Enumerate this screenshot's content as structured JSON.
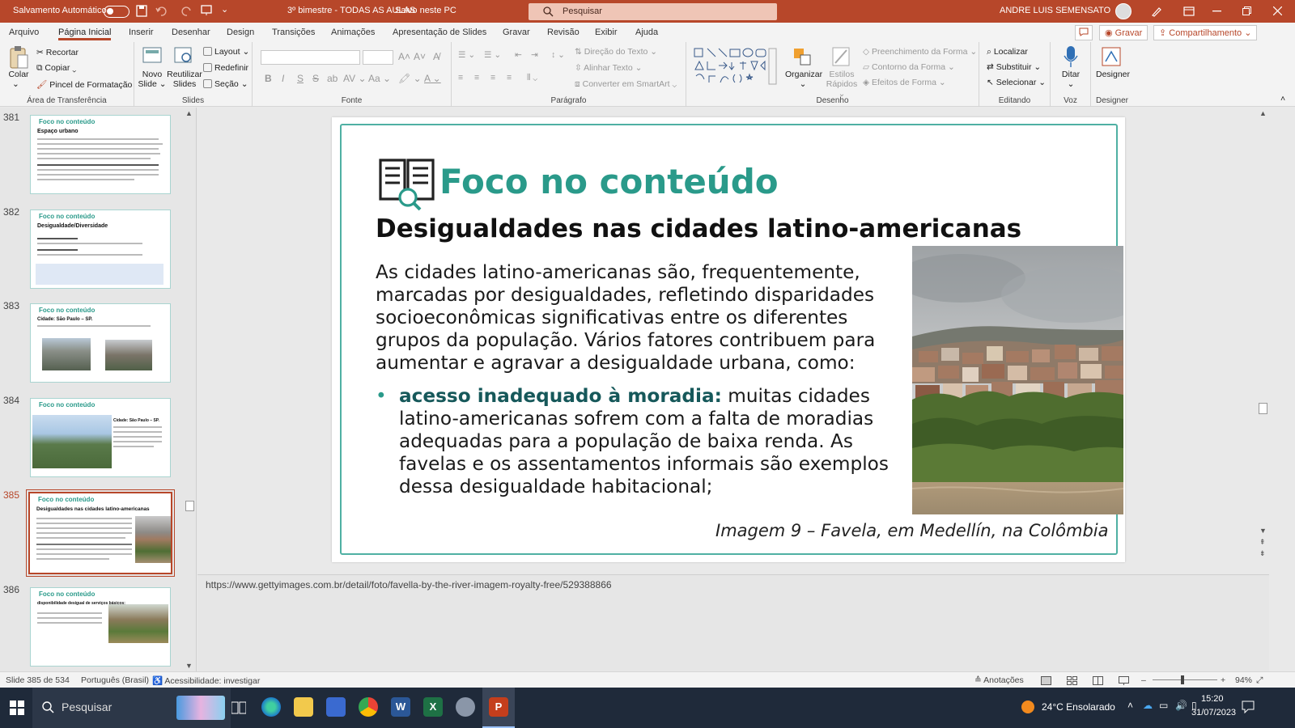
{
  "titlebar": {
    "autosave_label": "Salvamento Automático",
    "document_title": "3º bimestre - TODAS AS AULAS",
    "save_status": "Salvo neste PC",
    "search_placeholder": "Pesquisar",
    "user_name": "ANDRE LUIS SEMENSATO"
  },
  "tabs": [
    "Arquivo",
    "Página Inicial",
    "Inserir",
    "Desenhar",
    "Design",
    "Transições",
    "Animações",
    "Apresentação de Slides",
    "Gravar",
    "Revisão",
    "Exibir",
    "Ajuda"
  ],
  "tab_buttons": {
    "record": "Gravar",
    "share": "Compartilhamento"
  },
  "ribbon": {
    "clipboard": {
      "paste": "Colar",
      "cut": "Recortar",
      "copy": "Copiar",
      "format_painter": "Pincel de Formatação",
      "label": "Área de Transferência"
    },
    "slides": {
      "new_slide_1": "Novo",
      "new_slide_2": "Slide",
      "reuse_1": "Reutilizar",
      "reuse_2": "Slides",
      "layout": "Layout",
      "reset": "Redefinir",
      "section": "Seção",
      "label": "Slides"
    },
    "font": {
      "label": "Fonte"
    },
    "paragraph": {
      "text_direction": "Direção do Texto",
      "align_text": "Alinhar Texto",
      "smartart": "Converter em SmartArt",
      "label": "Parágrafo"
    },
    "drawing": {
      "arrange": "Organizar",
      "quick_styles_1": "Estilos",
      "quick_styles_2": "Rápidos",
      "shape_fill": "Preenchimento da Forma",
      "shape_outline": "Contorno da Forma",
      "shape_effects": "Efeitos de Forma",
      "label": "Desenho"
    },
    "editing": {
      "find": "Localizar",
      "replace": "Substituir",
      "select": "Selecionar",
      "label": "Editando"
    },
    "voice": {
      "dictate": "Ditar",
      "label": "Voz"
    },
    "designer": {
      "designer": "Designer",
      "label": "Designer"
    }
  },
  "thumbnails": [
    {
      "num": "381",
      "title": "Foco no conteúdo",
      "subtitle": "Espaço urbano"
    },
    {
      "num": "382",
      "title": "Foco no conteúdo",
      "subtitle": "Desigualdade/Diversidade"
    },
    {
      "num": "383",
      "title": "Foco no conteúdo",
      "subtitle": "Cidade: São Paulo – SP."
    },
    {
      "num": "384",
      "title": "Foco no conteúdo",
      "subtitle": "Cidade: São Paulo – SP."
    },
    {
      "num": "385",
      "title": "Foco no conteúdo",
      "subtitle": "Desigualdades nas cidades latino-americanas"
    },
    {
      "num": "386",
      "title": "Foco no conteúdo",
      "subtitle": "disponibilidade desigual de serviços básicos:"
    }
  ],
  "slide": {
    "heading": "Foco no conteúdo",
    "subtitle": "Desigualdades nas cidades latino-americanas",
    "body_lines": [
      "As cidades latino-americanas são, frequentemente,",
      "marcadas por desigualdades, refletindo disparidades",
      "socioeconômicas significativas entre os diferentes",
      "grupos da população. Vários fatores contribuem para",
      "aumentar e agravar a desigualdade urbana, como:"
    ],
    "bullet_bold": "acesso inadequado à moradia:",
    "bullet_lines": [
      " muitas cidades",
      "latino-americanas sofrem com a falta de moradias",
      "adequadas para a população de baixa renda. As",
      "favelas e os assentamentos informais são exemplos",
      "dessa desigualdade habitacional;"
    ],
    "caption": "Imagem 9 – Favela, em Medellín, na Colômbia"
  },
  "notes": "https://www.gettyimages.com.br/detail/foto/favella-by-the-river-imagem-royalty-free/529388866",
  "status": {
    "slide_count": "Slide 385 de 534",
    "language": "Português (Brasil)",
    "accessibility": "Acessibilidade: investigar",
    "notes_button": "Anotações",
    "zoom": "94%"
  },
  "taskbar": {
    "search": "Pesquisar",
    "weather": "24°C  Ensolarado",
    "time": "15:20",
    "date": "31/07/2023"
  },
  "colors": {
    "accent": "#b7472a",
    "teal": "#2a9a8a"
  }
}
